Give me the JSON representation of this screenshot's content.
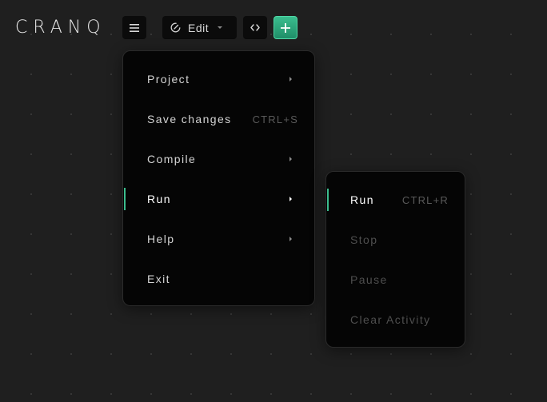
{
  "logo": {
    "text": "CRANQ"
  },
  "toolbar": {
    "edit_label": "Edit"
  },
  "icons": {
    "hamburger": "hamburger-menu-icon",
    "edit": "edit-icon",
    "code": "code-brackets-icon",
    "add": "plus-icon"
  },
  "colors": {
    "accent": "#3bbd8e",
    "background": "#1f1f1f",
    "menu_bg": "#050505"
  },
  "main_menu": {
    "items": [
      {
        "label": "Project",
        "shortcut": "",
        "submenu": true
      },
      {
        "label": "Save changes",
        "shortcut": "CTRL+S",
        "submenu": false
      },
      {
        "label": "Compile",
        "shortcut": "",
        "submenu": true
      },
      {
        "label": "Run",
        "shortcut": "",
        "submenu": true
      },
      {
        "label": "Help",
        "shortcut": "",
        "submenu": true
      },
      {
        "label": "Exit",
        "shortcut": "",
        "submenu": false
      }
    ]
  },
  "run_submenu": {
    "items": [
      {
        "label": "Run",
        "shortcut": "CTRL+R",
        "enabled": true
      },
      {
        "label": "Stop",
        "shortcut": "",
        "enabled": false
      },
      {
        "label": "Pause",
        "shortcut": "",
        "enabled": false
      },
      {
        "label": "Clear Activity",
        "shortcut": "",
        "enabled": false
      }
    ]
  }
}
